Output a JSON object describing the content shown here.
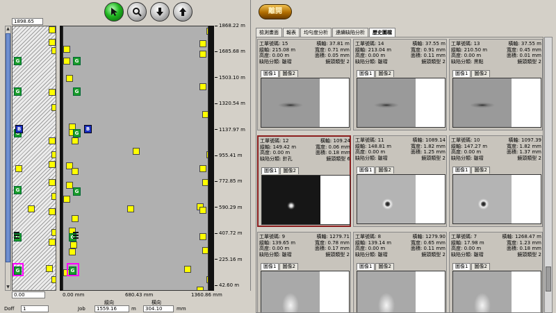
{
  "toolbar": {
    "buttons": [
      {
        "name": "cursor-icon",
        "active": true
      },
      {
        "name": "zoom-icon",
        "active": false
      },
      {
        "name": "down-arrow-icon",
        "active": false
      },
      {
        "name": "up-arrow-icon",
        "active": false
      }
    ]
  },
  "plot": {
    "top_value": "1898.65",
    "y_ticks": [
      "1868.22 m",
      "1685.68 m",
      "1503.10 m",
      "1320.54 m",
      "1137.97 m",
      "955.41 m",
      "772.85 m",
      "590.29 m",
      "407.72 m",
      "225.16 m",
      "42.60 m"
    ],
    "x_ticks": [
      "0.00 mm",
      "680.43 mm",
      "1360.86 mm"
    ],
    "narrow_bottom_value": "0.00"
  },
  "bottom": {
    "doff_label": "Doff",
    "doff_value": "1",
    "job_label": "Job",
    "vertical_label": "縱向",
    "vertical_value": "1559.16",
    "vertical_unit": "m",
    "horizontal_label": "橫向",
    "horizontal_value": "304.10",
    "horizontal_unit": "mm"
  },
  "right": {
    "exit_label": "離開",
    "tabs": [
      "檢測畫面",
      "報表",
      "均勻度分析",
      "連續缺陷分析",
      "歷史圖檔"
    ],
    "active_tab": 4
  },
  "cards": [
    {
      "work": "15",
      "h": "37.81 m",
      "v": "215.08 m",
      "w": "0.71 mm",
      "ht": "0.00 m",
      "area": "0.05 mm",
      "cls": "皺褶",
      "lens": "鏡頭類型 2",
      "img": "streak"
    },
    {
      "work": "14",
      "h": "37.55 m",
      "v": "213.04 m",
      "w": "0.91 mm",
      "ht": "0.00 m",
      "area": "0.11 mm",
      "cls": "皺褶",
      "lens": "鏡頭類型 2",
      "img": "streak"
    },
    {
      "work": "13",
      "h": "37.55 m",
      "v": "210.50 m",
      "w": "0.45 mm",
      "ht": "0.00 m",
      "area": "0.01 mm",
      "cls": "黑點",
      "lens": "鏡頭類型 2",
      "img": "streak"
    },
    {
      "work": "12",
      "h": "109.24",
      "v": "149.42 m",
      "w": "0.06 mm",
      "ht": "0.00 m",
      "area": "0.18 mm",
      "cls": "針孔",
      "lens": "鏡頭類型 6",
      "img": "hole",
      "active": true
    },
    {
      "work": "11",
      "h": "1089.14",
      "v": "148.81 m",
      "w": "1.82 mm",
      "ht": "0.00 m",
      "area": "1.25 mm",
      "cls": "皺褶",
      "lens": "鏡頭類型 2",
      "img": "bubble"
    },
    {
      "work": "10",
      "h": "1097.39",
      "v": "147.27 m",
      "w": "1.82 mm",
      "ht": "0.00 m",
      "area": "1.37 mm",
      "cls": "皺褶",
      "lens": "鏡頭類型 2",
      "img": "bubble"
    },
    {
      "work": "9",
      "h": "1279.71",
      "v": "139.65 m",
      "w": "0.78 mm",
      "ht": "0.00 m",
      "area": "0.17 mm",
      "cls": "皺褶",
      "lens": "鏡頭類型 2",
      "img": "fade"
    },
    {
      "work": "8",
      "h": "1279.90",
      "v": "139.14 m",
      "w": "0.65 mm",
      "ht": "0.00 m",
      "area": "0.11 mm",
      "cls": "皺褶",
      "lens": "鏡頭類型 2",
      "img": "fade"
    },
    {
      "work": "7",
      "h": "1268.47 m",
      "v": "17.98 m",
      "w": "1.23 mm",
      "ht": "0.00 m",
      "area": "0.18 mm",
      "cls": "皺褶",
      "lens": "鏡頭類型 2",
      "img": "fade"
    }
  ],
  "card_labels": {
    "work": "工單號碼:",
    "h": "橫軸:",
    "v": "縱軸:",
    "w": "寬度:",
    "ht": "高度:",
    "area": "面積:",
    "cls": "缺陷分類:",
    "image1": "圖像1",
    "image2": "圖像2"
  },
  "markers": {
    "g_label": "G",
    "b_label": "B"
  }
}
